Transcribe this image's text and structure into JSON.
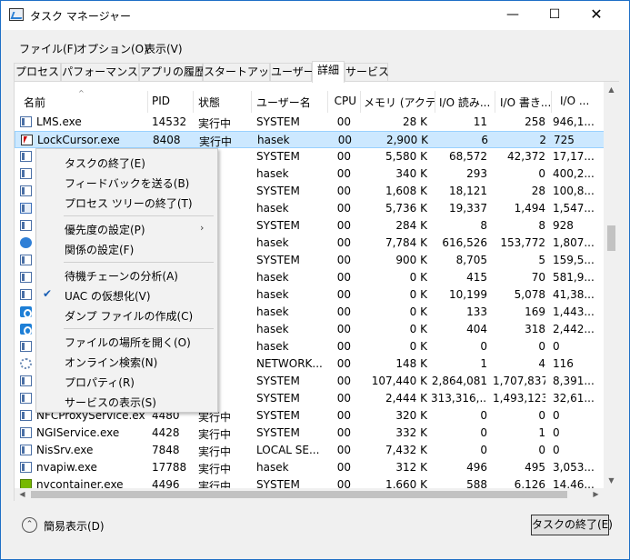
{
  "window": {
    "title": "タスク マネージャー"
  },
  "menubar": [
    {
      "label": "ファイル(F)"
    },
    {
      "label": "オプション(O)"
    },
    {
      "label": "表示(V)"
    }
  ],
  "tabs": [
    {
      "label": "プロセス"
    },
    {
      "label": "パフォーマンス"
    },
    {
      "label": "アプリの履歴"
    },
    {
      "label": "スタートアップ"
    },
    {
      "label": "ユーザー"
    },
    {
      "label": "詳細",
      "active": true
    },
    {
      "label": "サービス"
    }
  ],
  "table": {
    "columns": [
      "名前",
      "PID",
      "状態",
      "ユーザー名",
      "CPU",
      "メモリ (アクテ...",
      "I/O 読み...",
      "I/O 書き...",
      "I/O ..."
    ],
    "sort_indicator": "^",
    "rows": [
      {
        "icon": "window",
        "name": "LMS.exe",
        "pid": "14532",
        "status": "実行中",
        "user": "SYSTEM",
        "cpu": "00",
        "mem": "28 K",
        "ior": "11",
        "iow": "258",
        "io": "946,1..."
      },
      {
        "icon": "cursor",
        "name": "LockCursor.exe",
        "pid": "8408",
        "status": "実行中",
        "user": "hasek",
        "cpu": "00",
        "mem": "2,900 K",
        "ior": "6",
        "iow": "2",
        "io": "725",
        "selected": true
      },
      {
        "icon": "window",
        "name": "",
        "pid": "",
        "status": "",
        "user": "SYSTEM",
        "cpu": "00",
        "mem": "5,580 K",
        "ior": "68,572",
        "iow": "42,372",
        "io": "17,17..."
      },
      {
        "icon": "window",
        "name": "",
        "pid": "",
        "status": "",
        "user": "hasek",
        "cpu": "00",
        "mem": "340 K",
        "ior": "293",
        "iow": "0",
        "io": "400,2..."
      },
      {
        "icon": "window",
        "name": "",
        "pid": "",
        "status": "",
        "user": "SYSTEM",
        "cpu": "00",
        "mem": "1,608 K",
        "ior": "18,121",
        "iow": "28",
        "io": "100,8..."
      },
      {
        "icon": "multi",
        "name": "",
        "pid": "",
        "status": "",
        "user": "hasek",
        "cpu": "00",
        "mem": "5,736 K",
        "ior": "19,337",
        "iow": "1,494",
        "io": "1,547..."
      },
      {
        "icon": "window",
        "name": "",
        "pid": "",
        "status": "",
        "user": "SYSTEM",
        "cpu": "00",
        "mem": "284 K",
        "ior": "8",
        "iow": "8",
        "io": "928"
      },
      {
        "icon": "globe",
        "name": "",
        "pid": "",
        "status": "",
        "user": "hasek",
        "cpu": "00",
        "mem": "7,784 K",
        "ior": "616,526",
        "iow": "153,772",
        "io": "1,807..."
      },
      {
        "icon": "window",
        "name": "",
        "pid": "",
        "status": "",
        "user": "SYSTEM",
        "cpu": "00",
        "mem": "900 K",
        "ior": "8,705",
        "iow": "5",
        "io": "159,5..."
      },
      {
        "icon": "window",
        "name": "",
        "pid": "",
        "status": "",
        "user": "hasek",
        "cpu": "00",
        "mem": "0 K",
        "ior": "415",
        "iow": "70",
        "io": "581,9..."
      },
      {
        "icon": "window",
        "name": "",
        "pid": "",
        "status": "",
        "user": "hasek",
        "cpu": "00",
        "mem": "0 K",
        "ior": "10,199",
        "iow": "5,078",
        "io": "41,38..."
      },
      {
        "icon": "ie",
        "name": "",
        "pid": "",
        "status": "",
        "user": "hasek",
        "cpu": "00",
        "mem": "0 K",
        "ior": "133",
        "iow": "169",
        "io": "1,443..."
      },
      {
        "icon": "ie",
        "name": "",
        "pid": "",
        "status": "",
        "user": "hasek",
        "cpu": "00",
        "mem": "0 K",
        "ior": "404",
        "iow": "318",
        "io": "2,442..."
      },
      {
        "icon": "window",
        "name": "",
        "pid": "",
        "status": "",
        "user": "hasek",
        "cpu": "00",
        "mem": "0 K",
        "ior": "0",
        "iow": "0",
        "io": "0"
      },
      {
        "icon": "gear",
        "name": "",
        "pid": "",
        "status": "",
        "user": "NETWORK...",
        "cpu": "00",
        "mem": "148 K",
        "ior": "1",
        "iow": "4",
        "io": "116"
      },
      {
        "icon": "window",
        "name": "",
        "pid": "",
        "status": "",
        "user": "SYSTEM",
        "cpu": "00",
        "mem": "107,440 K",
        "ior": "2,864,081",
        "iow": "1,707,837",
        "io": "8,391..."
      },
      {
        "icon": "window",
        "name": "",
        "pid": "",
        "status": "",
        "user": "SYSTEM",
        "cpu": "00",
        "mem": "2,444 K",
        "ior": "313,316,...",
        "iow": "1,493,123",
        "io": "32,61..."
      },
      {
        "icon": "window",
        "name": "NFCProxyService.exe",
        "pid": "4480",
        "status": "実行中",
        "user": "SYSTEM",
        "cpu": "00",
        "mem": "320 K",
        "ior": "0",
        "iow": "0",
        "io": "0"
      },
      {
        "icon": "window",
        "name": "NGIService.exe",
        "pid": "4428",
        "status": "実行中",
        "user": "SYSTEM",
        "cpu": "00",
        "mem": "332 K",
        "ior": "0",
        "iow": "1",
        "io": "0"
      },
      {
        "icon": "window",
        "name": "NisSrv.exe",
        "pid": "7848",
        "status": "実行中",
        "user": "LOCAL SE...",
        "cpu": "00",
        "mem": "7,432 K",
        "ior": "0",
        "iow": "0",
        "io": "0"
      },
      {
        "icon": "window",
        "name": "nvapiw.exe",
        "pid": "17788",
        "status": "実行中",
        "user": "hasek",
        "cpu": "00",
        "mem": "312 K",
        "ior": "496",
        "iow": "495",
        "io": "3,053..."
      },
      {
        "icon": "nv",
        "name": "nvcontainer.exe",
        "pid": "4496",
        "status": "実行中",
        "user": "SYSTEM",
        "cpu": "00",
        "mem": "1,660 K",
        "ior": "588",
        "iow": "6,126",
        "io": "14,46..."
      }
    ]
  },
  "context_menu": {
    "items": [
      {
        "label": "タスクの終了(E)"
      },
      {
        "label": "フィードバックを送る(B)"
      },
      {
        "label": "プロセス ツリーの終了(T)"
      },
      {
        "separator": true
      },
      {
        "label": "優先度の設定(P)",
        "submenu": true
      },
      {
        "label": "関係の設定(F)"
      },
      {
        "separator": true
      },
      {
        "label": "待機チェーンの分析(A)"
      },
      {
        "label": "UAC の仮想化(V)",
        "checked": true
      },
      {
        "label": "ダンプ ファイルの作成(C)"
      },
      {
        "separator": true
      },
      {
        "label": "ファイルの場所を開く(O)"
      },
      {
        "label": "オンライン検索(N)"
      },
      {
        "label": "プロパティ(R)"
      },
      {
        "label": "サービスの表示(S)"
      }
    ]
  },
  "footer": {
    "fewer_details": "簡易表示(D)",
    "end_task": "タスクの終了(E)"
  }
}
